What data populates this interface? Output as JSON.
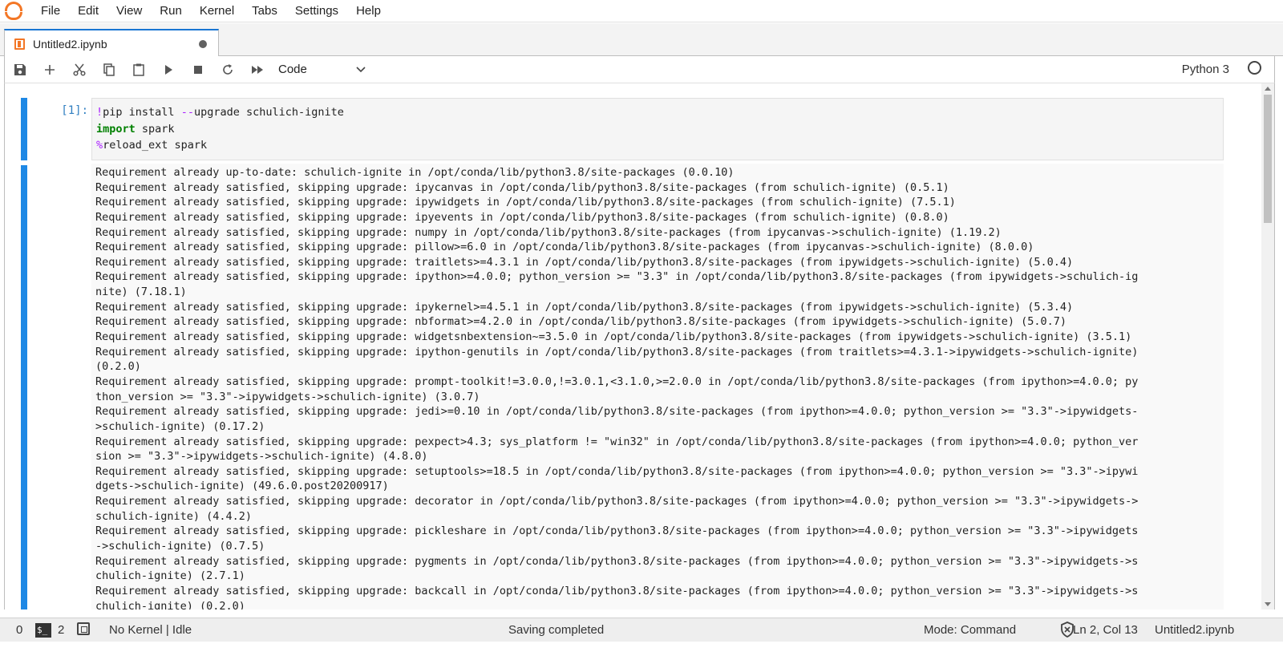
{
  "menu": [
    "File",
    "Edit",
    "View",
    "Run",
    "Kernel",
    "Tabs",
    "Settings",
    "Help"
  ],
  "tab": {
    "title": "Untitled2.ipynb"
  },
  "toolbar": {
    "cell_type": "Code",
    "kernel_name": "Python 3"
  },
  "cell": {
    "prompt": "[1]:",
    "code": {
      "line1_op": "!",
      "line1_rest": "pip install ",
      "line1_flag": "--",
      "line1_tail": "upgrade schulich-ignite",
      "line2_kw": "import",
      "line2_rest": " spark",
      "line3_magic": "%",
      "line3_rest": "reload_ext spark"
    },
    "output": [
      "Requirement already up-to-date: schulich-ignite in /opt/conda/lib/python3.8/site-packages (0.0.10)",
      "Requirement already satisfied, skipping upgrade: ipycanvas in /opt/conda/lib/python3.8/site-packages (from schulich-ignite) (0.5.1)",
      "Requirement already satisfied, skipping upgrade: ipywidgets in /opt/conda/lib/python3.8/site-packages (from schulich-ignite) (7.5.1)",
      "Requirement already satisfied, skipping upgrade: ipyevents in /opt/conda/lib/python3.8/site-packages (from schulich-ignite) (0.8.0)",
      "Requirement already satisfied, skipping upgrade: numpy in /opt/conda/lib/python3.8/site-packages (from ipycanvas->schulich-ignite) (1.19.2)",
      "Requirement already satisfied, skipping upgrade: pillow>=6.0 in /opt/conda/lib/python3.8/site-packages (from ipycanvas->schulich-ignite) (8.0.0)",
      "Requirement already satisfied, skipping upgrade: traitlets>=4.3.1 in /opt/conda/lib/python3.8/site-packages (from ipywidgets->schulich-ignite) (5.0.4)",
      "Requirement already satisfied, skipping upgrade: ipython>=4.0.0; python_version >= \"3.3\" in /opt/conda/lib/python3.8/site-packages (from ipywidgets->schulich-ig",
      "nite) (7.18.1)",
      "Requirement already satisfied, skipping upgrade: ipykernel>=4.5.1 in /opt/conda/lib/python3.8/site-packages (from ipywidgets->schulich-ignite) (5.3.4)",
      "Requirement already satisfied, skipping upgrade: nbformat>=4.2.0 in /opt/conda/lib/python3.8/site-packages (from ipywidgets->schulich-ignite) (5.0.7)",
      "Requirement already satisfied, skipping upgrade: widgetsnbextension~=3.5.0 in /opt/conda/lib/python3.8/site-packages (from ipywidgets->schulich-ignite) (3.5.1)",
      "Requirement already satisfied, skipping upgrade: ipython-genutils in /opt/conda/lib/python3.8/site-packages (from traitlets>=4.3.1->ipywidgets->schulich-ignite)",
      "(0.2.0)",
      "Requirement already satisfied, skipping upgrade: prompt-toolkit!=3.0.0,!=3.0.1,<3.1.0,>=2.0.0 in /opt/conda/lib/python3.8/site-packages (from ipython>=4.0.0; py",
      "thon_version >= \"3.3\"->ipywidgets->schulich-ignite) (3.0.7)",
      "Requirement already satisfied, skipping upgrade: jedi>=0.10 in /opt/conda/lib/python3.8/site-packages (from ipython>=4.0.0; python_version >= \"3.3\"->ipywidgets-",
      ">schulich-ignite) (0.17.2)",
      "Requirement already satisfied, skipping upgrade: pexpect>4.3; sys_platform != \"win32\" in /opt/conda/lib/python3.8/site-packages (from ipython>=4.0.0; python_ver",
      "sion >= \"3.3\"->ipywidgets->schulich-ignite) (4.8.0)",
      "Requirement already satisfied, skipping upgrade: setuptools>=18.5 in /opt/conda/lib/python3.8/site-packages (from ipython>=4.0.0; python_version >= \"3.3\"->ipywi",
      "dgets->schulich-ignite) (49.6.0.post20200917)",
      "Requirement already satisfied, skipping upgrade: decorator in /opt/conda/lib/python3.8/site-packages (from ipython>=4.0.0; python_version >= \"3.3\"->ipywidgets->",
      "schulich-ignite) (4.4.2)",
      "Requirement already satisfied, skipping upgrade: pickleshare in /opt/conda/lib/python3.8/site-packages (from ipython>=4.0.0; python_version >= \"3.3\"->ipywidgets",
      "->schulich-ignite) (0.7.5)",
      "Requirement already satisfied, skipping upgrade: pygments in /opt/conda/lib/python3.8/site-packages (from ipython>=4.0.0; python_version >= \"3.3\"->ipywidgets->s",
      "chulich-ignite) (2.7.1)",
      "Requirement already satisfied, skipping upgrade: backcall in /opt/conda/lib/python3.8/site-packages (from ipython>=4.0.0; python_version >= \"3.3\"->ipywidgets->s",
      "chulich-ignite) (0.2.0)"
    ]
  },
  "status": {
    "count_left": "0",
    "terminal_label": "$_",
    "terminals": "2",
    "kernel": "No Kernel | Idle",
    "message": "Saving completed",
    "mode": "Mode: Command",
    "cursor": "Ln 2, Col 13",
    "file": "Untitled2.ipynb"
  }
}
